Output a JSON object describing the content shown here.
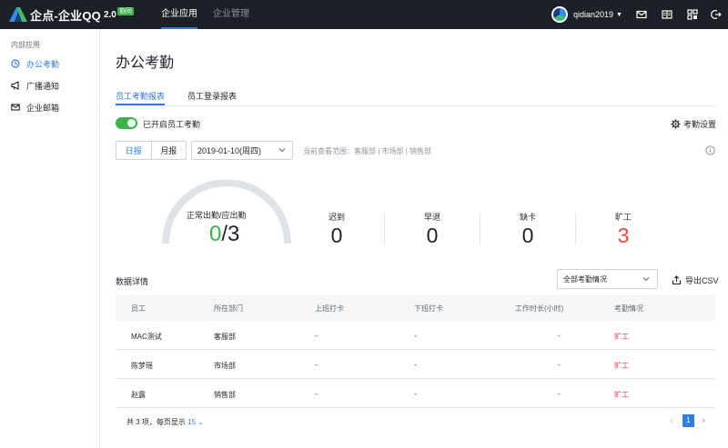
{
  "header": {
    "logo_text": "企点-企业QQ",
    "logo_version": "2.0",
    "logo_badge": "协同",
    "nav": [
      {
        "label": "企业应用",
        "active": true
      },
      {
        "label": "企业管理",
        "active": false
      }
    ],
    "username": "qidian2019",
    "icons": [
      "mail-icon",
      "book-icon",
      "grid-apps-icon",
      "logout-icon"
    ]
  },
  "sidebar": {
    "title": "内部应用",
    "items": [
      {
        "label": "办公考勤",
        "icon": "clock-icon",
        "active": true
      },
      {
        "label": "广播通知",
        "icon": "megaphone-icon",
        "active": false
      },
      {
        "label": "企业邮箱",
        "icon": "mail-icon",
        "active": false
      }
    ]
  },
  "main": {
    "title": "办公考勤",
    "tabs": [
      {
        "label": "员工考勤报表",
        "active": true
      },
      {
        "label": "员工登录报表",
        "active": false
      }
    ],
    "toggle": {
      "label": "已开启员工考勤",
      "on": true
    },
    "settings_label": "考勤设置",
    "period": {
      "options": [
        "日报",
        "月报"
      ],
      "selected": "日报"
    },
    "date_value": "2019-01-10(周四)",
    "scope_text": "当前查看范围：客服部 | 市场部 | 销售部",
    "summary": {
      "gauge_label": "正常出勤/应出勤",
      "normal": "0",
      "separator": "/",
      "expected": "3",
      "gauge_fraction": 0,
      "stats": [
        {
          "label": "迟到",
          "value": "0",
          "highlight": false
        },
        {
          "label": "早退",
          "value": "0",
          "highlight": false
        },
        {
          "label": "缺卡",
          "value": "0",
          "highlight": false
        },
        {
          "label": "旷工",
          "value": "3",
          "highlight": true
        }
      ]
    },
    "details_title": "数据详情",
    "filter_value": "全部考勤情况",
    "export_label": "导出CSV",
    "table": {
      "columns": [
        "员工",
        "所在部门",
        "上班打卡",
        "下班打卡",
        "工作时长(小时)",
        "考勤情况"
      ],
      "rows": [
        [
          "MAC测试",
          "客服部",
          "-",
          "-",
          "-",
          "旷工"
        ],
        [
          "陈梦瑶",
          "市场部",
          "-",
          "-",
          "-",
          "旷工"
        ],
        [
          "赵露",
          "销售部",
          "-",
          "-",
          "-",
          "旷工"
        ]
      ]
    },
    "pagination": {
      "summary_prefix": "共 3 项，每页显示",
      "page_size": "15",
      "current_page": "1"
    }
  },
  "colors": {
    "accent": "#2f7be8",
    "success": "#3cb34a",
    "danger": "#f5463b",
    "topbar": "#1b2127"
  }
}
